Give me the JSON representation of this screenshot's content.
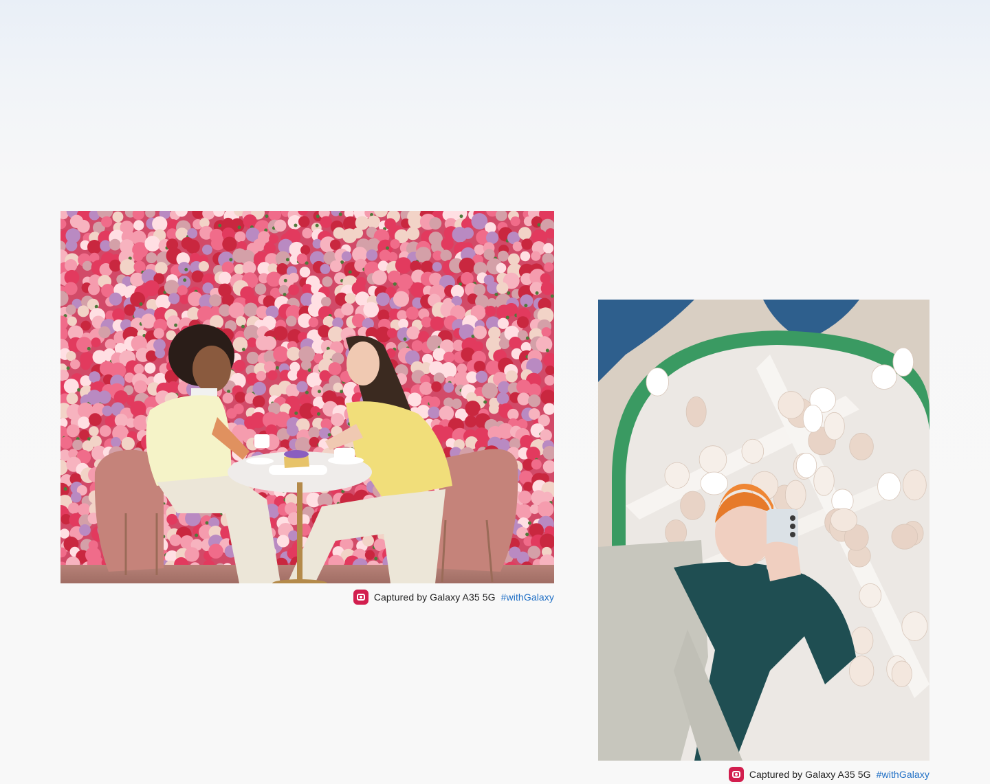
{
  "gallery": {
    "photo_1": {
      "caption_text": "Captured by Galaxy A35 5G",
      "caption_hashtag": "#withGalaxy",
      "icon": "camera-icon",
      "icon_color": "#d21e4e"
    },
    "photo_2": {
      "caption_text": "Captured by Galaxy A35 5G",
      "caption_hashtag": "#withGalaxy",
      "icon": "camera-icon",
      "icon_color": "#d21e4e"
    },
    "hashtag_color": "#1f6fc5"
  }
}
